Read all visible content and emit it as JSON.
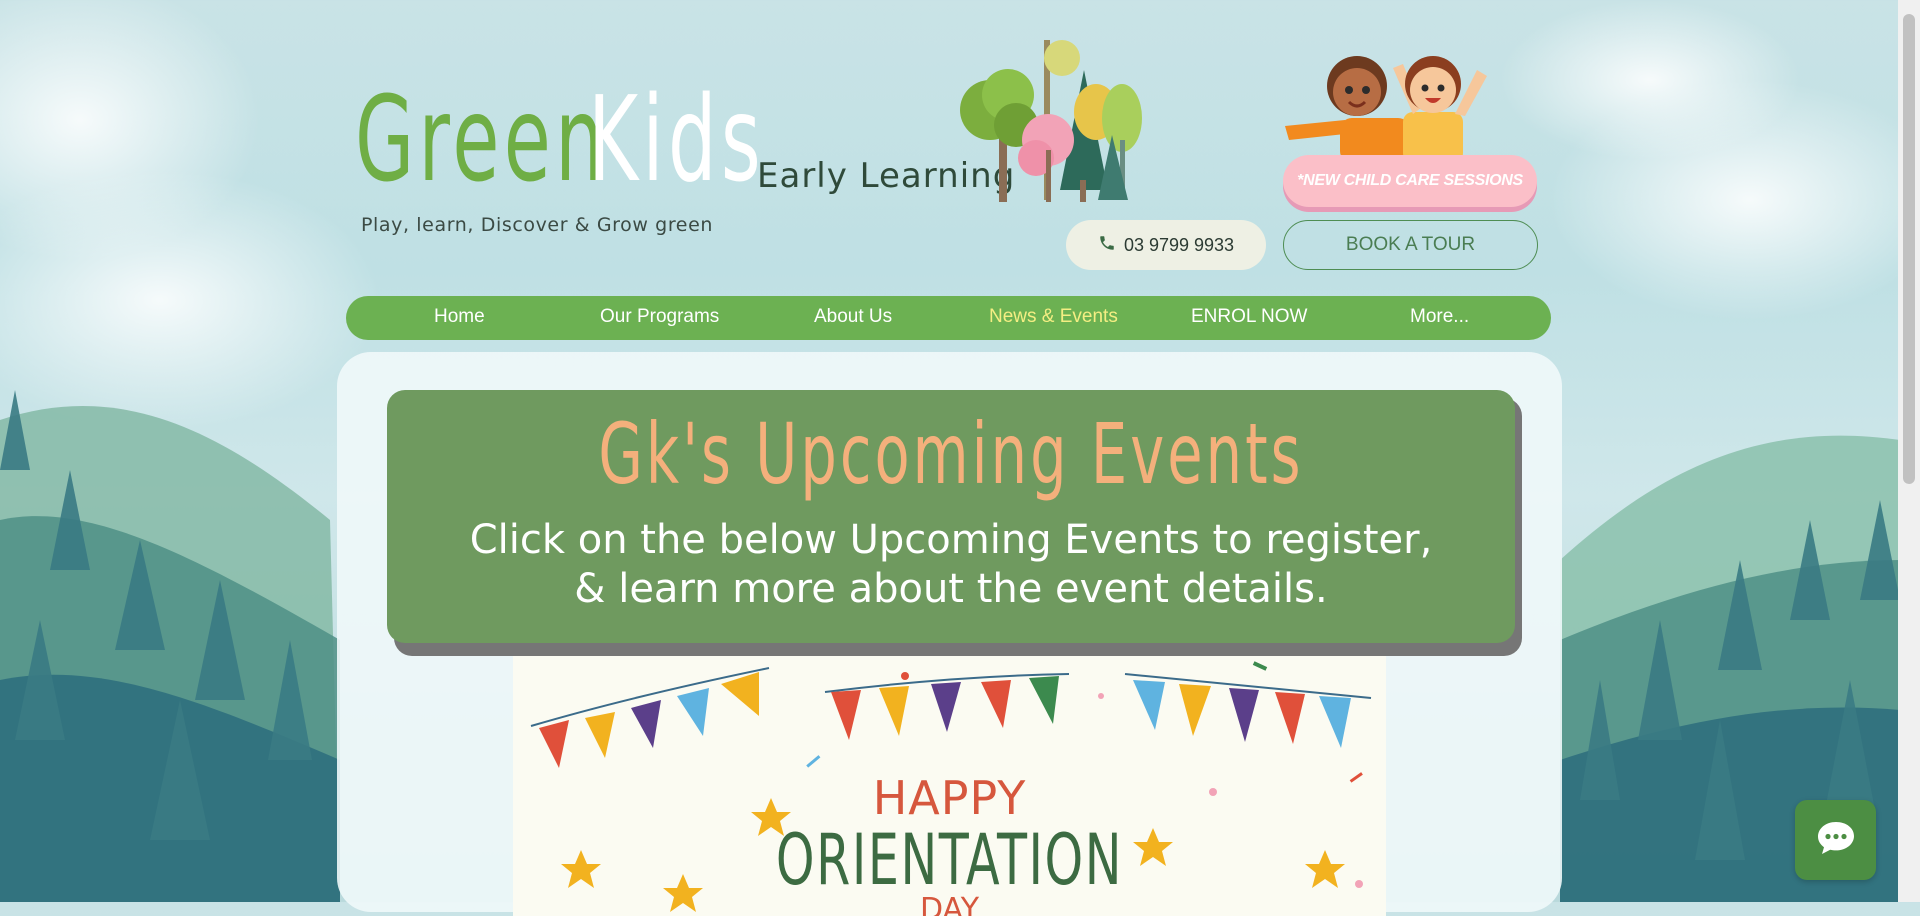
{
  "header": {
    "logo_green": "Green",
    "logo_kids": "Kids",
    "logo_subtitle": "Early Learning",
    "tagline": "Play, learn, Discover & Grow green",
    "new_sessions_label": "*NEW CHILD CARE SESSIONS",
    "phone_label": "03 9799 9933",
    "tour_label": "BOOK A TOUR"
  },
  "nav": {
    "items": [
      {
        "label": "Home"
      },
      {
        "label": "Our Programs"
      },
      {
        "label": "About Us"
      },
      {
        "label": "News & Events",
        "active": true
      },
      {
        "label": "ENROL NOW"
      },
      {
        "label": "More..."
      }
    ]
  },
  "banner": {
    "title": "Gk's Upcoming Events",
    "subtitle_line1": "Click on the below Upcoming Events to register,",
    "subtitle_line2": "& learn more about the event details."
  },
  "event": {
    "line1": "HAPPY",
    "line2": "ORIENTATION",
    "line3": "DAY"
  },
  "icons": {
    "phone": "phone-icon",
    "chat": "chat-icon"
  },
  "colors": {
    "nav_green": "#6cb152",
    "active_nav": "#f4ee83",
    "banner_green": "#6f9a5f",
    "banner_title": "#f4b07c",
    "pink_button": "#fbbfc8"
  }
}
